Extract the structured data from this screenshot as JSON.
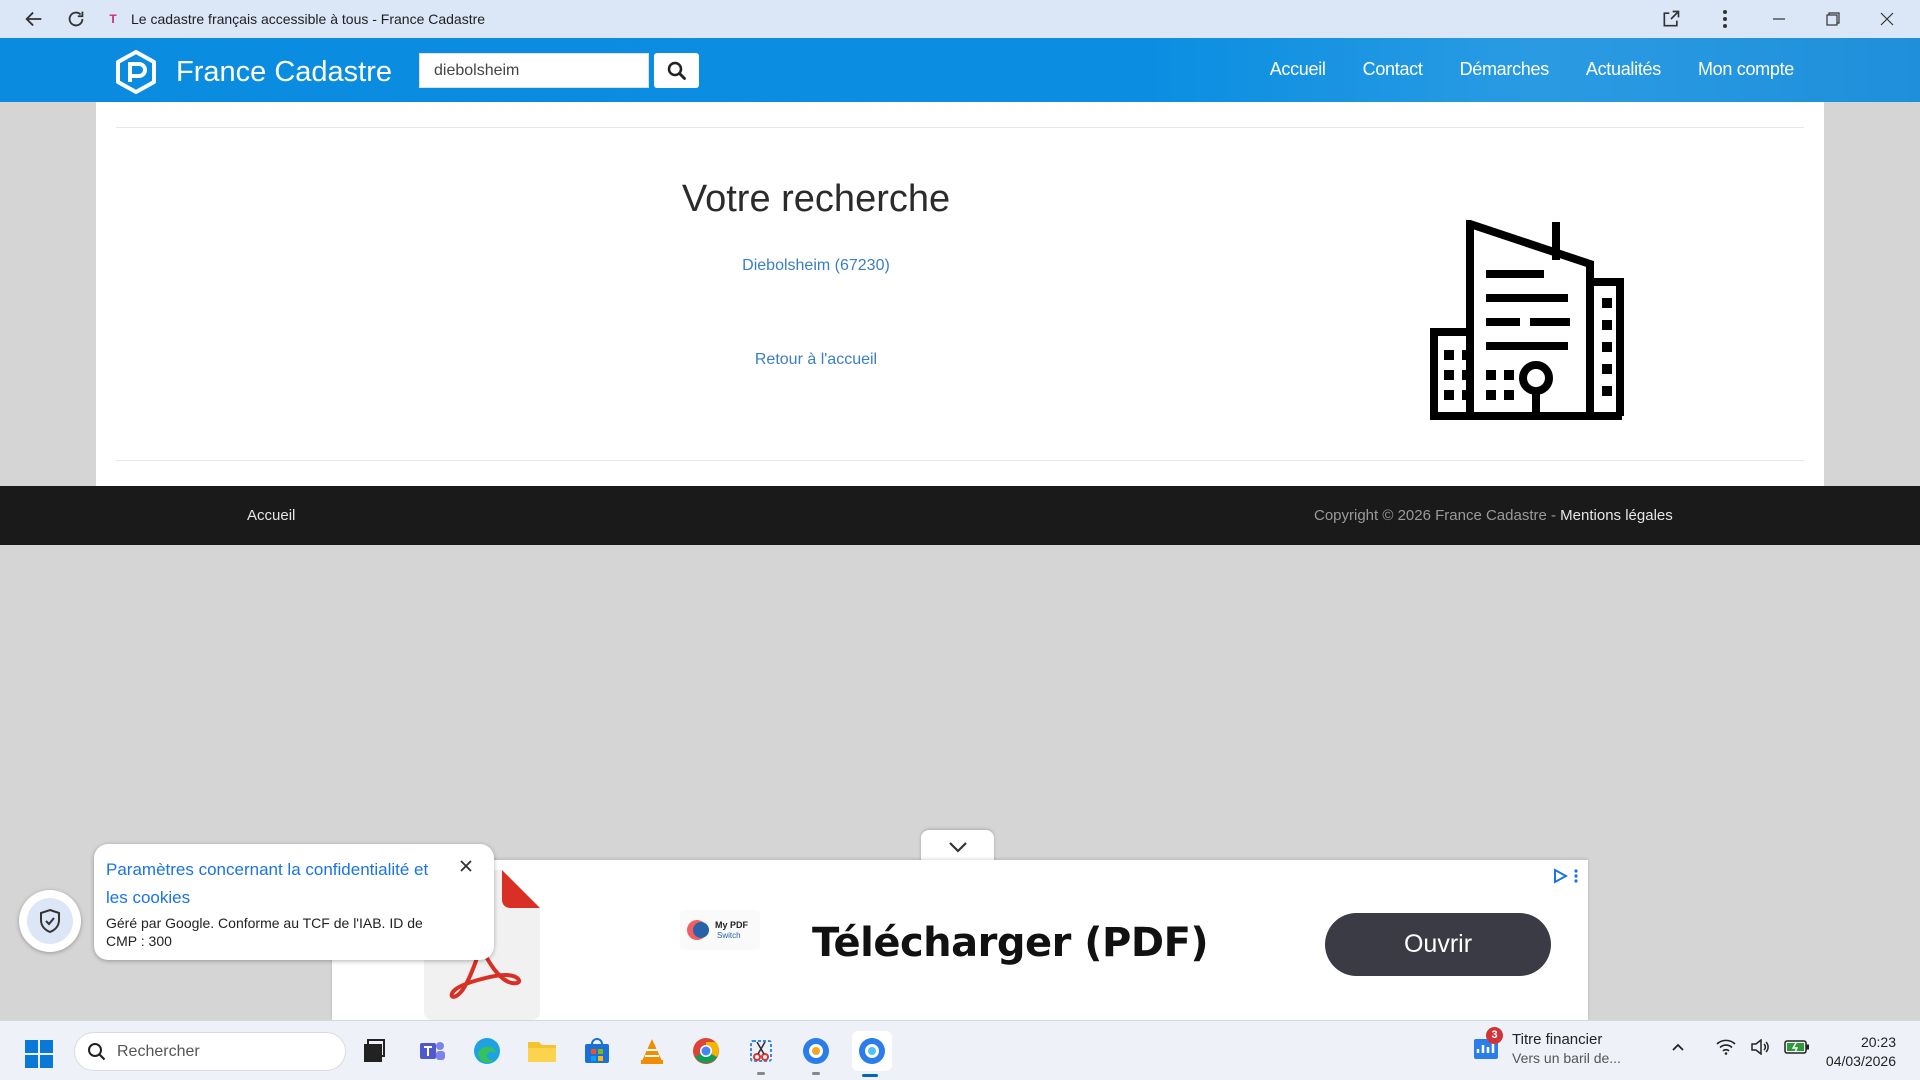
{
  "browser": {
    "tab_title": "Le cadastre français accessible à tous - France Cadastre",
    "favicon_letter": "T"
  },
  "header": {
    "brand": "France Cadastre",
    "search_value": "diebolsheim",
    "nav": [
      "Accueil",
      "Contact",
      "Démarches",
      "Actualités",
      "Mon compte"
    ]
  },
  "main": {
    "title": "Votre recherche",
    "result_link": "Diebolsheim (67230)",
    "back_link": "Retour à l'accueil"
  },
  "footer": {
    "home": "Accueil",
    "copyright": "Copyright © 2026 France Cadastre - ",
    "legal": "Mentions légales"
  },
  "ad": {
    "title": "Télécharger (PDF)",
    "cta": "Ouvrir",
    "sponsor_line1": "My PDF",
    "sponsor_line2": "Switch"
  },
  "privacy": {
    "title": "Paramètres concernant la confidentialité et les cookies",
    "subtitle": "Géré par Google. Conforme au TCF de l'IAB. ID de CMP : 300"
  },
  "taskbar": {
    "search_placeholder": "Rechercher",
    "widget_badge": "3",
    "widget_title": "Titre financier",
    "widget_sub": "Vers un baril de...",
    "time": "20:23",
    "date": "04/03/2026"
  },
  "colors": {
    "header_blue": "#0a8be0",
    "link_blue": "#3a7fc4",
    "footer_dark": "#1a1a1a",
    "cta_dark": "#3a3b45"
  }
}
